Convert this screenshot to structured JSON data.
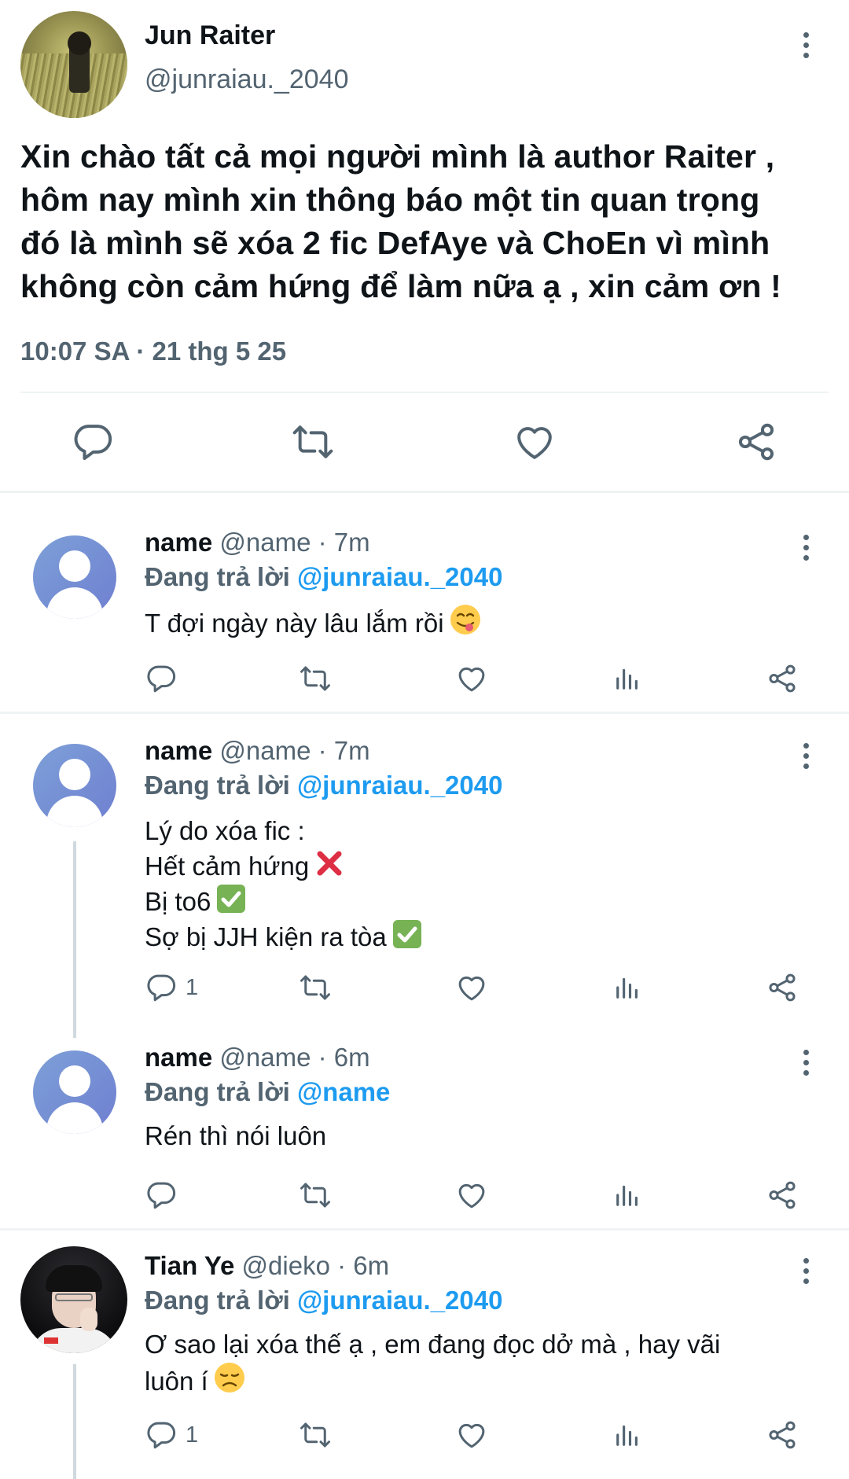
{
  "main_tweet": {
    "author_name": "Jun Raiter",
    "author_handle": "@junraiau._2040",
    "text_lines": [
      "Xin chào tất cả mọi người mình là author Raiter ,",
      "hôm nay mình xin thông báo một tin quan trọng",
      "đó là mình sẽ xóa 2 fic DefAye và ChoEn vì mình",
      "không còn cảm hứng để làm nữa ạ , xin cảm ơn !"
    ],
    "timestamp": "10:07 SA · 21 thg 5 25",
    "actions": [
      "reply-icon",
      "retweet-icon",
      "like-icon",
      "share-icon"
    ]
  },
  "replies": [
    {
      "name": "name",
      "meta": "@name · 7m",
      "replying_prefix": "Đang trả lời",
      "replying_to": "@junraiau._2040",
      "text_lines": [
        "T đợi ngày này lâu lắm rồi"
      ],
      "emoji": "smiling-tongue-emoji",
      "reply_count": "",
      "avatar": "default-avatar"
    },
    {
      "name": "name",
      "meta": "@name · 7m",
      "replying_prefix": "Đang trả lời",
      "replying_to": "@junraiau._2040",
      "text_lines": [
        "Lý do xóa fic :",
        "Hết cảm hứng",
        "Bị to6",
        "Sợ bị JJH kiện ra tòa"
      ],
      "line_emojis": [
        "",
        "cross-mark-emoji",
        "check-mark-emoji",
        "check-mark-emoji"
      ],
      "reply_count": "1",
      "avatar": "default-avatar"
    },
    {
      "name": "name",
      "meta": "@name · 6m",
      "replying_prefix": "Đang trả lời",
      "replying_to": "@name",
      "text_lines": [
        "Rén thì nói luôn"
      ],
      "reply_count": "",
      "avatar": "default-avatar"
    },
    {
      "name": "Tian Ye",
      "meta": "@dieko · 6m",
      "replying_prefix": "Đang trả lời",
      "replying_to": "@junraiau._2040",
      "text_lines": [
        "Ơ sao lại xóa thế ạ , em đang đọc dở mà , hay vãi",
        "luôn í"
      ],
      "emoji": "disappointed-emoji",
      "reply_count": "1",
      "avatar": "photo-avatar"
    }
  ],
  "colors": {
    "text": "#0f1419",
    "secondary": "#536471",
    "link": "#1d9bf0",
    "divider": "#eff3f4",
    "thread_line": "#cfd9de"
  }
}
